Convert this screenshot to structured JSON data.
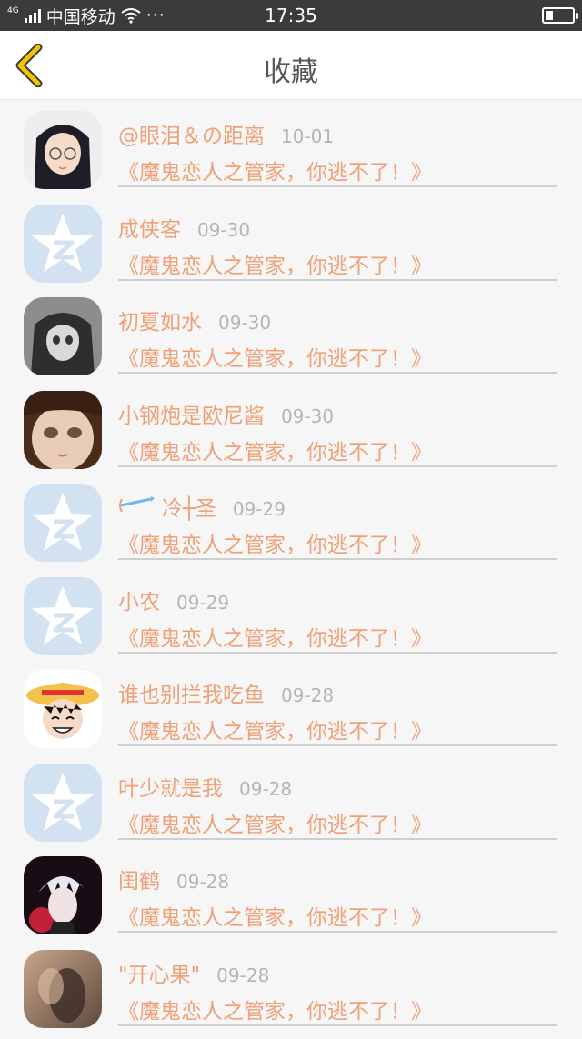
{
  "status_bar": {
    "network_type": "4G",
    "carrier": "中国移动",
    "more": "···",
    "time": "17:35",
    "battery_level": 0.25
  },
  "nav": {
    "title": "收藏",
    "back_icon": "chevron-left-icon"
  },
  "colors": {
    "accent": "#f0a077",
    "back_arrow": "#f5c400",
    "date": "#b5b5b5"
  },
  "items": [
    {
      "name": "@眼泪＆の距离",
      "date": "10-01",
      "title": "《魔鬼恋人之管家，你逃不了！》",
      "avatar": "anime-girl-glasses"
    },
    {
      "name": "成侠客",
      "date": "09-30",
      "title": "《魔鬼恋人之管家，你逃不了！》",
      "avatar": "default-qzone-star"
    },
    {
      "name": "初夏如水",
      "date": "09-30",
      "title": "《魔鬼恋人之管家，你逃不了！》",
      "avatar": "grey-anime-girl"
    },
    {
      "name": "小钢炮是欧尼酱",
      "date": "09-30",
      "title": "《魔鬼恋人之管家，你逃不了！》",
      "avatar": "doll-face"
    },
    {
      "name": "冷┼圣",
      "date": "09-29",
      "title": "《魔鬼恋人之管家，你逃不了！》",
      "avatar": "default-qzone-star",
      "name_icon": "bow-arrow-icon"
    },
    {
      "name": "小农",
      "date": "09-29",
      "title": "《魔鬼恋人之管家，你逃不了！》",
      "avatar": "default-qzone-star"
    },
    {
      "name": "谁也别拦我吃鱼",
      "date": "09-28",
      "title": "《魔鬼恋人之管家，你逃不了！》",
      "avatar": "straw-hat-boy"
    },
    {
      "name": "叶少就是我",
      "date": "09-28",
      "title": "《魔鬼恋人之管家，你逃不了！》",
      "avatar": "default-qzone-star"
    },
    {
      "name": "闺鹤",
      "date": "09-28",
      "title": "《魔鬼恋人之管家，你逃不了！》",
      "avatar": "white-hair-boy"
    },
    {
      "name": "\"开心果\"",
      "date": "09-28",
      "title": "《魔鬼恋人之管家，你逃不了！》",
      "avatar": "blurry-photo"
    }
  ]
}
